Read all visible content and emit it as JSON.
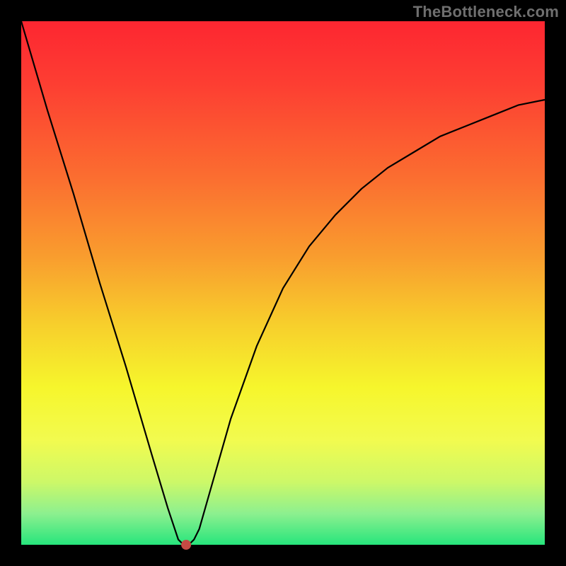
{
  "watermark": "TheBottleneck.com",
  "chart_data": {
    "type": "line",
    "title": "",
    "xlabel": "",
    "ylabel": "",
    "xlim": [
      0,
      100
    ],
    "ylim": [
      0,
      100
    ],
    "grid": false,
    "legend": false,
    "series": [
      {
        "name": "curve",
        "x": [
          0,
          5,
          10,
          15,
          20,
          25,
          28,
          30,
          31,
          32,
          33,
          34,
          36,
          40,
          45,
          50,
          55,
          60,
          65,
          70,
          75,
          80,
          85,
          90,
          95,
          100
        ],
        "values": [
          100,
          83,
          67,
          50,
          34,
          17,
          7,
          1,
          0,
          0,
          1,
          3,
          10,
          24,
          38,
          49,
          57,
          63,
          68,
          72,
          75,
          78,
          80,
          82,
          84,
          85
        ]
      }
    ],
    "marker": {
      "x": 31.5,
      "y": 0,
      "color": "#c54a44",
      "radius_px": 7
    }
  },
  "colors": {
    "curve_stroke": "#000000",
    "background_frame": "#000000"
  }
}
